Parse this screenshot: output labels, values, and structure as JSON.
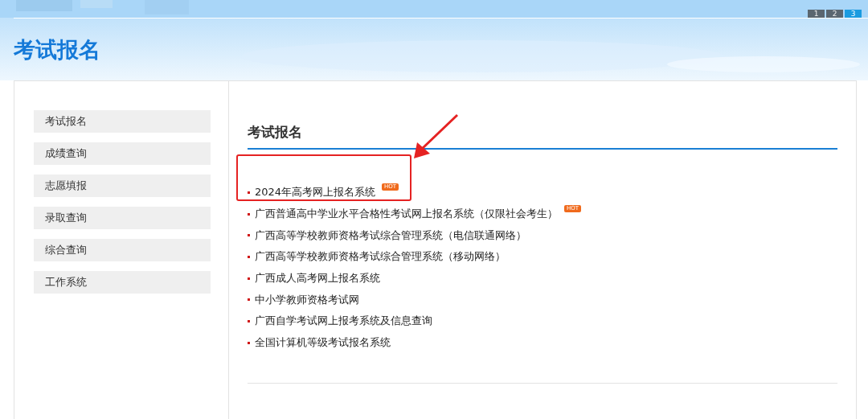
{
  "pager": [
    {
      "label": "1",
      "selected": false
    },
    {
      "label": "2",
      "selected": false
    },
    {
      "label": "3",
      "selected": true
    }
  ],
  "page_title": "考试报名",
  "sidebar": {
    "items": [
      {
        "label": "考试报名"
      },
      {
        "label": "成绩查询"
      },
      {
        "label": "志愿填报"
      },
      {
        "label": "录取查询"
      },
      {
        "label": "综合查询"
      },
      {
        "label": "工作系统"
      }
    ]
  },
  "content": {
    "heading": "考试报名",
    "links": [
      {
        "label": "2024年高考网上报名系统",
        "badge": "HOT",
        "highlighted": true
      },
      {
        "label": "广西普通高中学业水平合格性考试网上报名系统（仅限社会考生）",
        "badge": "HOT",
        "highlighted": false
      },
      {
        "label": "广西高等学校教师资格考试综合管理系统（电信联通网络）",
        "highlighted": false
      },
      {
        "label": "广西高等学校教师资格考试综合管理系统（移动网络）",
        "highlighted": false
      },
      {
        "label": "广西成人高考网上报名系统",
        "highlighted": false
      },
      {
        "label": "中小学教师资格考试网",
        "highlighted": false
      },
      {
        "label": "广西自学考试网上报考系统及信息查询",
        "highlighted": false
      },
      {
        "label": "全国计算机等级考试报名系统",
        "highlighted": false
      }
    ]
  }
}
